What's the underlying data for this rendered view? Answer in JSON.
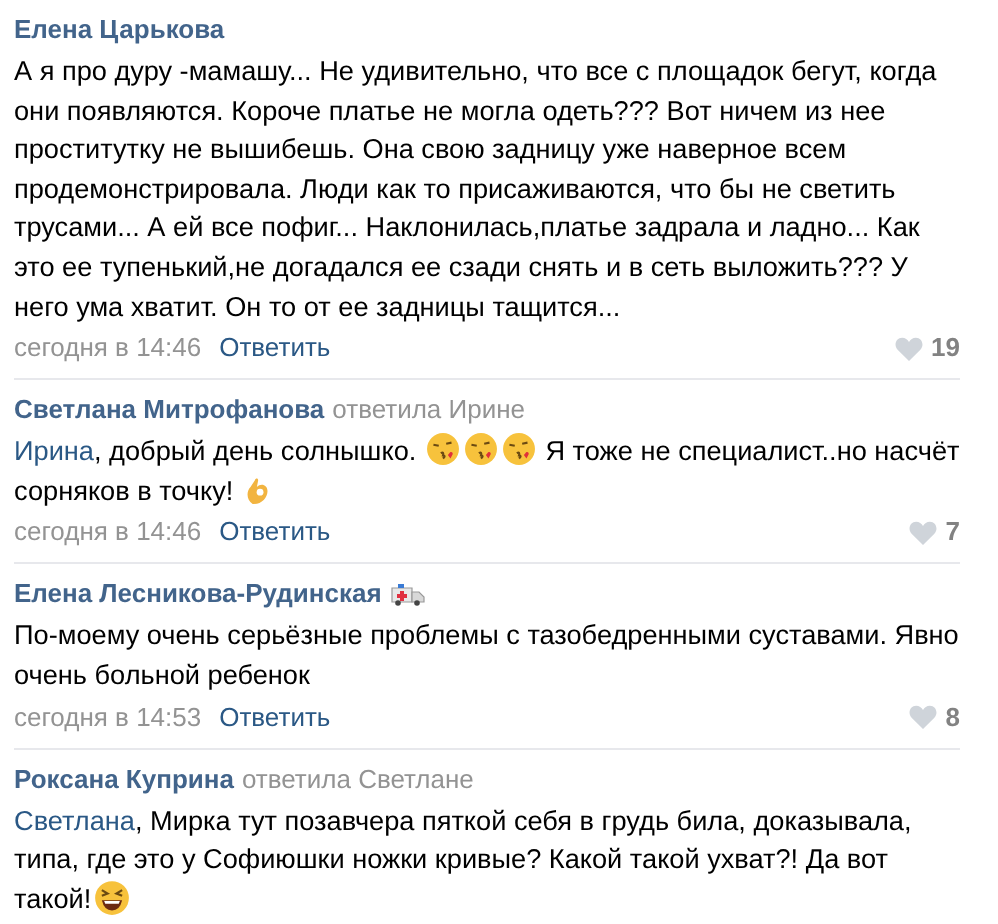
{
  "comments": [
    {
      "author": "Елена Царькова",
      "badge": false,
      "body": [
        {
          "kind": "text",
          "text": "А я про дуру -мамашу... Не удивительно, что все с площадок бегут, когда они появляются. Короче платье не могла одеть??? Вот ничем из нее проститутку не вышибешь. Она свою задницу уже наверное всем продемонстрировала. Люди как то присаживаются, что бы не светить трусами... А ей все пофиг... Наклонилась,платье задрала и ладно... Как это ее тупенький,не догадался ее сзади снять и в сеть выложить??? У него ума хватит. Он то от ее задницы тащится..."
        }
      ],
      "date": "сегодня в 14:46",
      "reply": "Ответить",
      "likes": "19"
    },
    {
      "author": "Светлана Митрофанова",
      "reply_to": "ответила Ирине",
      "badge": false,
      "body": [
        {
          "kind": "mention",
          "text": "Ирина"
        },
        {
          "kind": "text",
          "text": ", добрый день солнышко. "
        },
        {
          "kind": "kiss-emoji"
        },
        {
          "kind": "kiss-emoji"
        },
        {
          "kind": "kiss-emoji"
        },
        {
          "kind": "text",
          "text": " Я тоже не специалист..но насчёт сорняков в точку! "
        },
        {
          "kind": "ok-emoji"
        }
      ],
      "date": "сегодня в 14:46",
      "reply": "Ответить",
      "likes": "7"
    },
    {
      "author": "Елена Лесникова-Рудинская",
      "badge": true,
      "body": [
        {
          "kind": "text",
          "text": "По-моему очень серьёзные проблемы с тазобедренными суставами. Явно очень больной ребенок"
        }
      ],
      "date": "сегодня в 14:53",
      "reply": "Ответить",
      "likes": "8"
    },
    {
      "author": "Роксана Куприна",
      "reply_to": "ответила Светлане",
      "badge": false,
      "body": [
        {
          "kind": "mention",
          "text": "Светлана"
        },
        {
          "kind": "text",
          "text": ", Мирка тут позавчера пяткой себя в грудь била, доказывала, типа, где это у Софиюшки ножки кривые? Какой такой ухват?! Да вот такой!"
        },
        {
          "kind": "laugh-emoji"
        }
      ]
    }
  ]
}
